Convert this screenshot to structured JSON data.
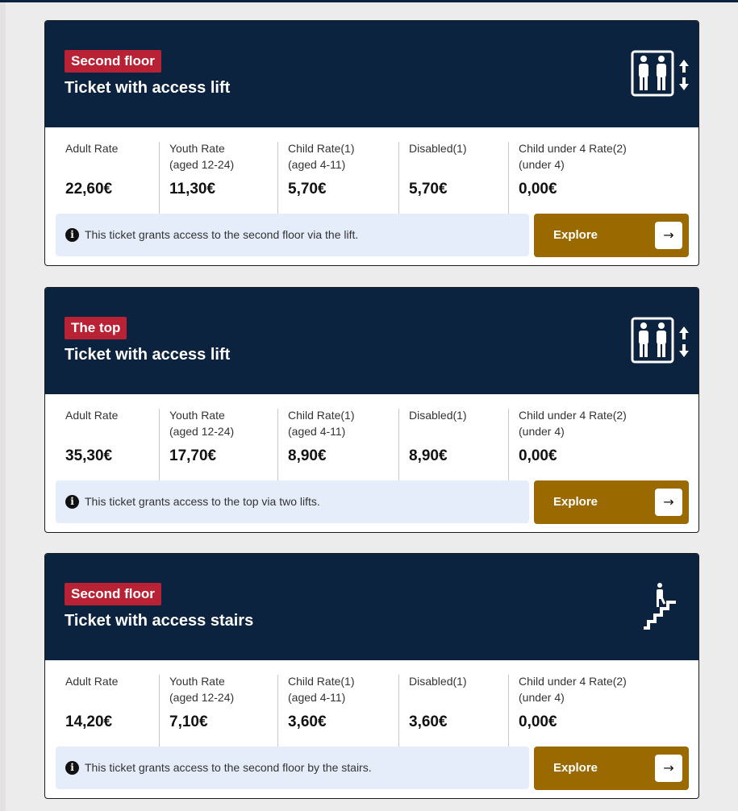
{
  "cards": [
    {
      "badge": "Second floor",
      "title": "Ticket with access lift",
      "icon": "lift-icon",
      "rates": [
        {
          "label": "Adult Rate",
          "sub": "",
          "price": "22,60€"
        },
        {
          "label": "Youth Rate",
          "sub": "(aged 12-24)",
          "price": "11,30€"
        },
        {
          "label": "Child Rate(1)",
          "sub": "(aged 4-11)",
          "price": "5,70€"
        },
        {
          "label": "Disabled(1)",
          "sub": "",
          "price": "5,70€"
        },
        {
          "label": "Child under 4 Rate(2)",
          "sub": "(under 4)",
          "price": "0,00€"
        }
      ],
      "info": "This ticket grants access to the second floor via the lift.",
      "button": "Explore"
    },
    {
      "badge": "The top",
      "title": "Ticket with access lift",
      "icon": "lift-icon",
      "rates": [
        {
          "label": "Adult Rate",
          "sub": "",
          "price": "35,30€"
        },
        {
          "label": "Youth Rate",
          "sub": "(aged 12-24)",
          "price": "17,70€"
        },
        {
          "label": "Child Rate(1)",
          "sub": "(aged 4-11)",
          "price": "8,90€"
        },
        {
          "label": "Disabled(1)",
          "sub": "",
          "price": "8,90€"
        },
        {
          "label": "Child under 4 Rate(2)",
          "sub": "(under 4)",
          "price": "0,00€"
        }
      ],
      "info": "This ticket grants access to the top via two lifts.",
      "button": "Explore"
    },
    {
      "badge": "Second floor",
      "title": "Ticket with access stairs",
      "icon": "stairs-icon",
      "rates": [
        {
          "label": "Adult Rate",
          "sub": "",
          "price": "14,20€"
        },
        {
          "label": "Youth Rate",
          "sub": "(aged 12-24)",
          "price": "7,10€"
        },
        {
          "label": "Child Rate(1)",
          "sub": "(aged 4-11)",
          "price": "3,60€"
        },
        {
          "label": "Disabled(1)",
          "sub": "",
          "price": "3,60€"
        },
        {
          "label": "Child under 4 Rate(2)",
          "sub": "(under 4)",
          "price": "0,00€"
        }
      ],
      "info": "This ticket grants access to the second floor by the stairs.",
      "button": "Explore"
    }
  ],
  "colors": {
    "header": "#0c2340",
    "badge": "#b82234",
    "button": "#9a6a00",
    "info_bg": "#e5edfa"
  }
}
